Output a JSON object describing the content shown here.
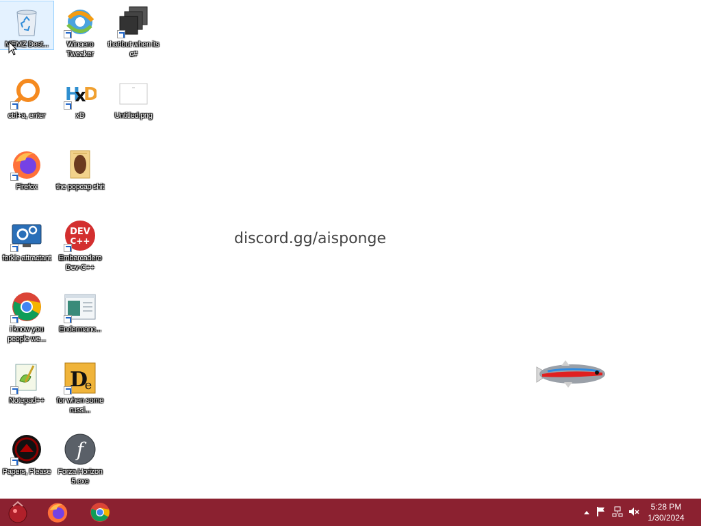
{
  "desktop": {
    "wallpaper_text": "discord.gg/aisponge",
    "icons": [
      {
        "label": "MEMZ Dest...",
        "icon": "recycle-bin-icon"
      },
      {
        "label": "Winaero Tweaker",
        "icon": "winaero-icon"
      },
      {
        "label": "that but when its c#",
        "icon": "stacked-windows-icon"
      },
      {
        "label": "ctrl+a, enter",
        "icon": "magnifier-icon"
      },
      {
        "label": "xD",
        "icon": "hxd-icon"
      },
      {
        "label": "Untitled.png",
        "icon": "image-file-icon"
      },
      {
        "label": "Firefox",
        "icon": "firefox-icon"
      },
      {
        "label": "the popcap shit",
        "icon": "folder-icon"
      },
      {
        "label": "forkie attractant",
        "icon": "monitor-settings-icon"
      },
      {
        "label": "Embarcadero Dev-C++",
        "icon": "devcpp-icon"
      },
      {
        "label": "i know you people we...",
        "icon": "chrome-icon"
      },
      {
        "label": "Endermanc...",
        "icon": "window-app-icon"
      },
      {
        "label": "Notepad++",
        "icon": "notepadpp-icon"
      },
      {
        "label": "for when some russi...",
        "icon": "de-app-icon"
      },
      {
        "label": "Papers, Please",
        "icon": "papers-please-icon"
      },
      {
        "label": "Forza Horizon 5.exe",
        "icon": "flash-icon"
      }
    ]
  },
  "taskbar": {
    "pinned": [
      {
        "name": "start-orb",
        "icon": "start-icon"
      },
      {
        "name": "firefox",
        "icon": "firefox-icon"
      },
      {
        "name": "chrome",
        "icon": "chrome-icon"
      }
    ],
    "tray": {
      "icons": [
        "chevron-up-icon",
        "flag-icon",
        "network-icon",
        "volume-muted-icon"
      ]
    },
    "clock": {
      "time": "5:28 PM",
      "date": "1/30/2024"
    }
  },
  "colors": {
    "taskbar": "#8b2130",
    "desktop": "#ffffff"
  }
}
